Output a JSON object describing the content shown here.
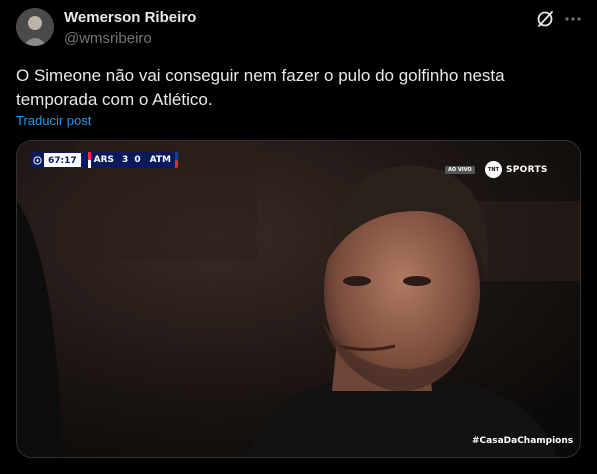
{
  "author": {
    "display_name": "Wemerson Ribeiro",
    "handle": "@wmsribeiro"
  },
  "icons": {
    "grok": "grok-icon",
    "more": "more-horizontal-icon"
  },
  "tweet": {
    "text": "O Simeone não vai conseguir nem fazer o pulo do golfinho nesta\ntemporada com o Atlético.",
    "translate_label": "Traducir post"
  },
  "media": {
    "scorebug": {
      "time": "67:17",
      "home": "ARS",
      "home_score": "3",
      "away_score": "0",
      "away": "ATM"
    },
    "live_badge": "AO VIVO",
    "tnt_mark": "TNT",
    "broadcaster": "SPORTS",
    "hashtag": "#CasaDaChampions"
  },
  "colors": {
    "background": "#000000",
    "text": "#e7e9ea",
    "secondary_text": "#71767b",
    "link": "#1d9bf0",
    "border": "#2f3336"
  }
}
